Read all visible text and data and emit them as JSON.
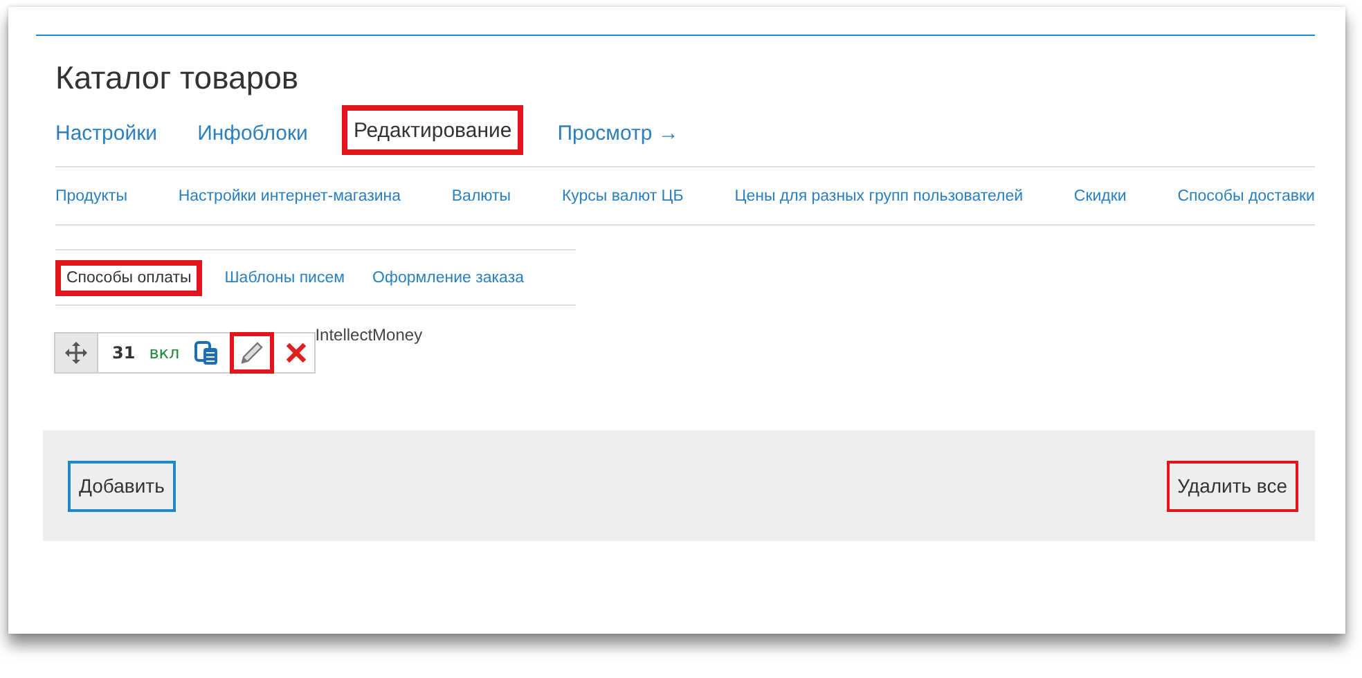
{
  "title": "Каталог товаров",
  "tabs": [
    {
      "label": "Настройки",
      "selected": false,
      "highlighted": false
    },
    {
      "label": "Инфоблоки",
      "selected": false,
      "highlighted": false
    },
    {
      "label": "Редактирование",
      "selected": true,
      "highlighted": true
    },
    {
      "label": "Просмотр →",
      "selected": false,
      "highlighted": false
    }
  ],
  "subnav": [
    "Продукты",
    "Настройки интернет-магазина",
    "Валюты",
    "Курсы валют ЦБ",
    "Цены для разных групп пользователей",
    "Скидки",
    "Способы доставки"
  ],
  "subtabs": [
    {
      "label": "Способы оплаты",
      "selected": true,
      "highlighted": true
    },
    {
      "label": "Шаблоны писем",
      "selected": false,
      "highlighted": false
    },
    {
      "label": "Оформление заказа",
      "selected": false,
      "highlighted": false
    }
  ],
  "items": [
    {
      "sort": "31",
      "status": "вкл",
      "name": "IntellectMoney",
      "edit_highlighted": true
    }
  ],
  "footer": {
    "add": "Добавить",
    "delete_all": "Удалить все"
  }
}
